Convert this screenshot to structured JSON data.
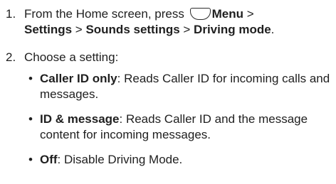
{
  "steps": [
    {
      "number": "1.",
      "parts": {
        "prefix": "From the Home screen, press",
        "menu_label": "Menu",
        "sep1": " >",
        "settings": "Settings",
        "sep2": " > ",
        "sounds_settings": "Sounds settings",
        "sep3": " > ",
        "driving_mode": "Driving mode",
        "end": "."
      },
      "icon": "menu-key-icon"
    },
    {
      "number": "2.",
      "text": "Choose a setting:"
    }
  ],
  "options": [
    {
      "bullet": "•",
      "term": "Caller ID only",
      "description": ": Reads Caller ID for incoming calls and messages."
    },
    {
      "bullet": "•",
      "term": "ID & message",
      "description": ": Reads Caller ID and the message content for incoming messages."
    },
    {
      "bullet": "•",
      "term": "Off",
      "description": ": Disable Driving Mode."
    }
  ]
}
